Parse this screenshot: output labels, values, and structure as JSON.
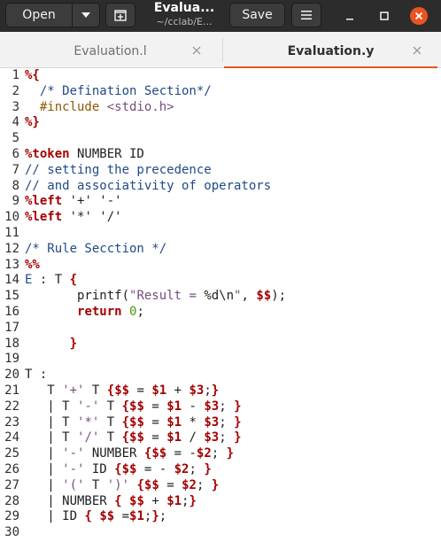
{
  "header": {
    "open_label": "Open",
    "title": "Evalua...",
    "subtitle": "~/cclab/E...",
    "save_label": "Save"
  },
  "tabs": [
    {
      "label": "Evaluation.l",
      "active": false
    },
    {
      "label": "Evaluation.y",
      "active": true
    }
  ],
  "colors": {
    "accent": "#e95420",
    "header_bg": "#2c2c2c"
  },
  "editor": {
    "line_numbers": [
      "1",
      "2",
      "3",
      "4",
      "5",
      "6",
      "7",
      "8",
      "9",
      "10",
      "11",
      "12",
      "13",
      "14",
      "15",
      "16",
      "17",
      "18",
      "19",
      "20",
      "21",
      "22",
      "23",
      "24",
      "25",
      "26",
      "27",
      "28",
      "29",
      "30"
    ],
    "lines": [
      [
        [
          "dir",
          "%{"
        ]
      ],
      [
        [
          "plain",
          "  "
        ],
        [
          "com",
          "/* Defination Section*/"
        ]
      ],
      [
        [
          "plain",
          "  "
        ],
        [
          "pre",
          "#include "
        ],
        [
          "str",
          "<stdio.h>"
        ]
      ],
      [
        [
          "dir",
          "%}"
        ]
      ],
      [],
      [
        [
          "dir",
          "%token"
        ],
        [
          "plain",
          " NUMBER ID"
        ]
      ],
      [
        [
          "com",
          "// setting the precedence"
        ]
      ],
      [
        [
          "com",
          "// and associativity of operators"
        ]
      ],
      [
        [
          "dir",
          "%left"
        ],
        [
          "plain",
          " '+' '-'"
        ]
      ],
      [
        [
          "dir",
          "%left"
        ],
        [
          "plain",
          " '*' '/'"
        ]
      ],
      [],
      [
        [
          "com",
          "/* Rule Secction */"
        ]
      ],
      [
        [
          "dir",
          "%%"
        ]
      ],
      [
        [
          "com",
          "E"
        ],
        [
          "plain",
          " : T "
        ],
        [
          "kw",
          "{"
        ]
      ],
      [
        [
          "plain",
          "       printf("
        ],
        [
          "str",
          "\"Result = "
        ],
        [
          "plain",
          "%d\\n"
        ],
        [
          "str",
          "\""
        ],
        [
          "plain",
          ", "
        ],
        [
          "var",
          "$$"
        ],
        [
          "plain",
          ");"
        ]
      ],
      [
        [
          "plain",
          "       "
        ],
        [
          "kw",
          "return"
        ],
        [
          "plain",
          " "
        ],
        [
          "num",
          "0"
        ],
        [
          "plain",
          ";"
        ]
      ],
      [],
      [
        [
          "plain",
          "      "
        ],
        [
          "kw",
          "}"
        ]
      ],
      [],
      [
        [
          "plain",
          "T :"
        ]
      ],
      [
        [
          "plain",
          "   T "
        ],
        [
          "str",
          "'+'"
        ],
        [
          "plain",
          " T "
        ],
        [
          "kw",
          "{"
        ],
        [
          "var",
          "$$"
        ],
        [
          "plain",
          " = "
        ],
        [
          "var",
          "$1"
        ],
        [
          "plain",
          " + "
        ],
        [
          "var",
          "$3"
        ],
        [
          "plain",
          ";"
        ],
        [
          "kw",
          "}"
        ]
      ],
      [
        [
          "plain",
          "   | T "
        ],
        [
          "str",
          "'-'"
        ],
        [
          "plain",
          " T "
        ],
        [
          "kw",
          "{"
        ],
        [
          "var",
          "$$"
        ],
        [
          "plain",
          " = "
        ],
        [
          "var",
          "$1"
        ],
        [
          "plain",
          " - "
        ],
        [
          "var",
          "$3"
        ],
        [
          "plain",
          "; "
        ],
        [
          "kw",
          "}"
        ]
      ],
      [
        [
          "plain",
          "   | T "
        ],
        [
          "str",
          "'*'"
        ],
        [
          "plain",
          " T "
        ],
        [
          "kw",
          "{"
        ],
        [
          "var",
          "$$"
        ],
        [
          "plain",
          " = "
        ],
        [
          "var",
          "$1"
        ],
        [
          "plain",
          " * "
        ],
        [
          "var",
          "$3"
        ],
        [
          "plain",
          "; "
        ],
        [
          "kw",
          "}"
        ]
      ],
      [
        [
          "plain",
          "   | T "
        ],
        [
          "str",
          "'/'"
        ],
        [
          "plain",
          " T "
        ],
        [
          "kw",
          "{"
        ],
        [
          "var",
          "$$"
        ],
        [
          "plain",
          " = "
        ],
        [
          "var",
          "$1"
        ],
        [
          "plain",
          " / "
        ],
        [
          "var",
          "$3"
        ],
        [
          "plain",
          "; "
        ],
        [
          "kw",
          "}"
        ]
      ],
      [
        [
          "plain",
          "   | "
        ],
        [
          "str",
          "'-'"
        ],
        [
          "plain",
          " NUMBER "
        ],
        [
          "kw",
          "{"
        ],
        [
          "var",
          "$$"
        ],
        [
          "plain",
          " = -"
        ],
        [
          "var",
          "$2"
        ],
        [
          "plain",
          "; "
        ],
        [
          "kw",
          "}"
        ]
      ],
      [
        [
          "plain",
          "   | "
        ],
        [
          "str",
          "'-'"
        ],
        [
          "plain",
          " ID "
        ],
        [
          "kw",
          "{"
        ],
        [
          "var",
          "$$"
        ],
        [
          "plain",
          " = - "
        ],
        [
          "var",
          "$2"
        ],
        [
          "plain",
          "; "
        ],
        [
          "kw",
          "}"
        ]
      ],
      [
        [
          "plain",
          "   | "
        ],
        [
          "str",
          "'('"
        ],
        [
          "plain",
          " T "
        ],
        [
          "str",
          "')'"
        ],
        [
          "plain",
          " "
        ],
        [
          "kw",
          "{"
        ],
        [
          "var",
          "$$"
        ],
        [
          "plain",
          " = "
        ],
        [
          "var",
          "$2"
        ],
        [
          "plain",
          "; "
        ],
        [
          "kw",
          "}"
        ]
      ],
      [
        [
          "plain",
          "   | NUMBER "
        ],
        [
          "kw",
          "{"
        ],
        [
          "plain",
          " "
        ],
        [
          "var",
          "$$"
        ],
        [
          "plain",
          " + "
        ],
        [
          "var",
          "$1"
        ],
        [
          "plain",
          ";"
        ],
        [
          "kw",
          "}"
        ]
      ],
      [
        [
          "plain",
          "   | ID "
        ],
        [
          "kw",
          "{"
        ],
        [
          "plain",
          " "
        ],
        [
          "var",
          "$$"
        ],
        [
          "plain",
          " ="
        ],
        [
          "var",
          "$1"
        ],
        [
          "plain",
          ";"
        ],
        [
          "kw",
          "}"
        ],
        [
          "plain",
          ";"
        ]
      ],
      []
    ]
  }
}
